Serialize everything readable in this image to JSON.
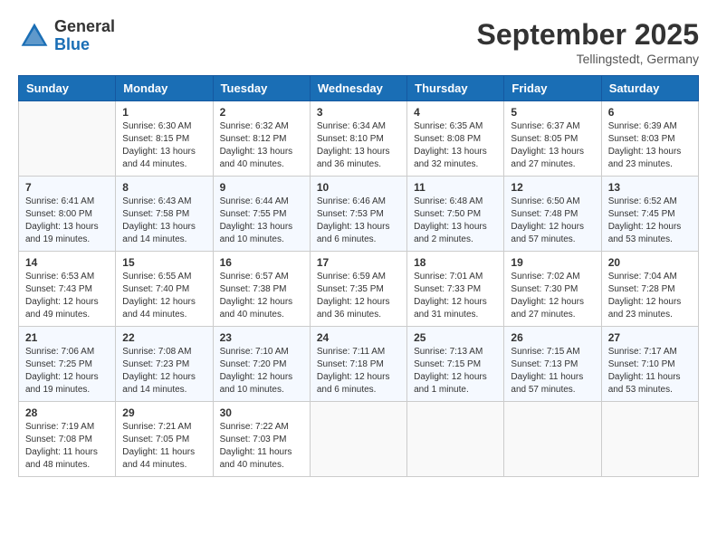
{
  "header": {
    "logo_general": "General",
    "logo_blue": "Blue",
    "month_title": "September 2025",
    "location": "Tellingstedt, Germany"
  },
  "days_of_week": [
    "Sunday",
    "Monday",
    "Tuesday",
    "Wednesday",
    "Thursday",
    "Friday",
    "Saturday"
  ],
  "weeks": [
    [
      {
        "day": "",
        "info": ""
      },
      {
        "day": "1",
        "info": "Sunrise: 6:30 AM\nSunset: 8:15 PM\nDaylight: 13 hours\nand 44 minutes."
      },
      {
        "day": "2",
        "info": "Sunrise: 6:32 AM\nSunset: 8:12 PM\nDaylight: 13 hours\nand 40 minutes."
      },
      {
        "day": "3",
        "info": "Sunrise: 6:34 AM\nSunset: 8:10 PM\nDaylight: 13 hours\nand 36 minutes."
      },
      {
        "day": "4",
        "info": "Sunrise: 6:35 AM\nSunset: 8:08 PM\nDaylight: 13 hours\nand 32 minutes."
      },
      {
        "day": "5",
        "info": "Sunrise: 6:37 AM\nSunset: 8:05 PM\nDaylight: 13 hours\nand 27 minutes."
      },
      {
        "day": "6",
        "info": "Sunrise: 6:39 AM\nSunset: 8:03 PM\nDaylight: 13 hours\nand 23 minutes."
      }
    ],
    [
      {
        "day": "7",
        "info": "Sunrise: 6:41 AM\nSunset: 8:00 PM\nDaylight: 13 hours\nand 19 minutes."
      },
      {
        "day": "8",
        "info": "Sunrise: 6:43 AM\nSunset: 7:58 PM\nDaylight: 13 hours\nand 14 minutes."
      },
      {
        "day": "9",
        "info": "Sunrise: 6:44 AM\nSunset: 7:55 PM\nDaylight: 13 hours\nand 10 minutes."
      },
      {
        "day": "10",
        "info": "Sunrise: 6:46 AM\nSunset: 7:53 PM\nDaylight: 13 hours\nand 6 minutes."
      },
      {
        "day": "11",
        "info": "Sunrise: 6:48 AM\nSunset: 7:50 PM\nDaylight: 13 hours\nand 2 minutes."
      },
      {
        "day": "12",
        "info": "Sunrise: 6:50 AM\nSunset: 7:48 PM\nDaylight: 12 hours\nand 57 minutes."
      },
      {
        "day": "13",
        "info": "Sunrise: 6:52 AM\nSunset: 7:45 PM\nDaylight: 12 hours\nand 53 minutes."
      }
    ],
    [
      {
        "day": "14",
        "info": "Sunrise: 6:53 AM\nSunset: 7:43 PM\nDaylight: 12 hours\nand 49 minutes."
      },
      {
        "day": "15",
        "info": "Sunrise: 6:55 AM\nSunset: 7:40 PM\nDaylight: 12 hours\nand 44 minutes."
      },
      {
        "day": "16",
        "info": "Sunrise: 6:57 AM\nSunset: 7:38 PM\nDaylight: 12 hours\nand 40 minutes."
      },
      {
        "day": "17",
        "info": "Sunrise: 6:59 AM\nSunset: 7:35 PM\nDaylight: 12 hours\nand 36 minutes."
      },
      {
        "day": "18",
        "info": "Sunrise: 7:01 AM\nSunset: 7:33 PM\nDaylight: 12 hours\nand 31 minutes."
      },
      {
        "day": "19",
        "info": "Sunrise: 7:02 AM\nSunset: 7:30 PM\nDaylight: 12 hours\nand 27 minutes."
      },
      {
        "day": "20",
        "info": "Sunrise: 7:04 AM\nSunset: 7:28 PM\nDaylight: 12 hours\nand 23 minutes."
      }
    ],
    [
      {
        "day": "21",
        "info": "Sunrise: 7:06 AM\nSunset: 7:25 PM\nDaylight: 12 hours\nand 19 minutes."
      },
      {
        "day": "22",
        "info": "Sunrise: 7:08 AM\nSunset: 7:23 PM\nDaylight: 12 hours\nand 14 minutes."
      },
      {
        "day": "23",
        "info": "Sunrise: 7:10 AM\nSunset: 7:20 PM\nDaylight: 12 hours\nand 10 minutes."
      },
      {
        "day": "24",
        "info": "Sunrise: 7:11 AM\nSunset: 7:18 PM\nDaylight: 12 hours\nand 6 minutes."
      },
      {
        "day": "25",
        "info": "Sunrise: 7:13 AM\nSunset: 7:15 PM\nDaylight: 12 hours\nand 1 minute."
      },
      {
        "day": "26",
        "info": "Sunrise: 7:15 AM\nSunset: 7:13 PM\nDaylight: 11 hours\nand 57 minutes."
      },
      {
        "day": "27",
        "info": "Sunrise: 7:17 AM\nSunset: 7:10 PM\nDaylight: 11 hours\nand 53 minutes."
      }
    ],
    [
      {
        "day": "28",
        "info": "Sunrise: 7:19 AM\nSunset: 7:08 PM\nDaylight: 11 hours\nand 48 minutes."
      },
      {
        "day": "29",
        "info": "Sunrise: 7:21 AM\nSunset: 7:05 PM\nDaylight: 11 hours\nand 44 minutes."
      },
      {
        "day": "30",
        "info": "Sunrise: 7:22 AM\nSunset: 7:03 PM\nDaylight: 11 hours\nand 40 minutes."
      },
      {
        "day": "",
        "info": ""
      },
      {
        "day": "",
        "info": ""
      },
      {
        "day": "",
        "info": ""
      },
      {
        "day": "",
        "info": ""
      }
    ]
  ]
}
